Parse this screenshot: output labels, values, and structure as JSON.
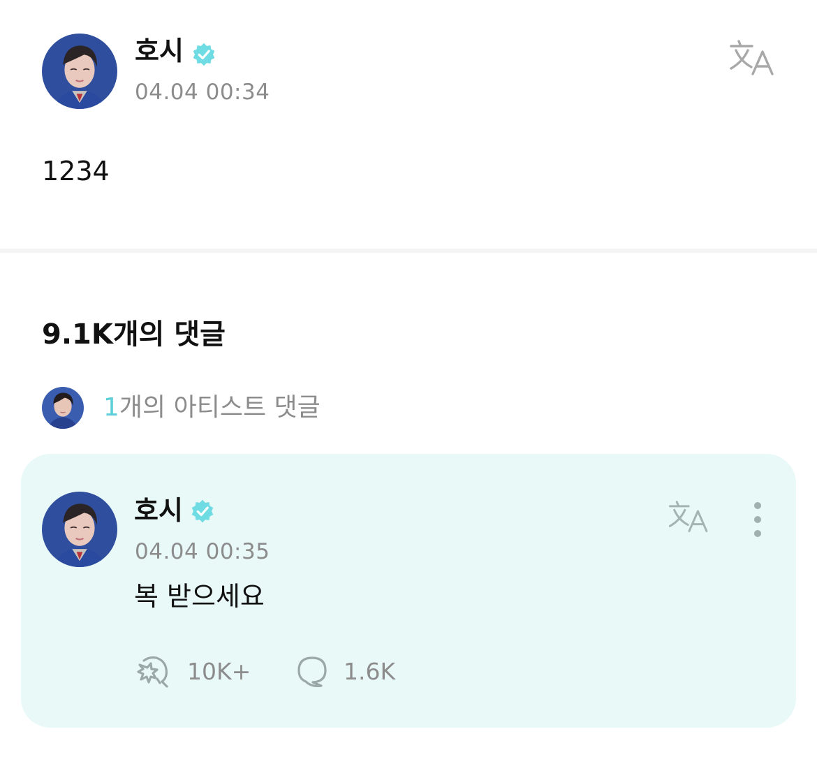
{
  "post": {
    "author_name": "호시",
    "timestamp": "04.04 00:34",
    "body": "1234",
    "translate_icon": "translate-icon",
    "verified_icon": "verified-badge-icon"
  },
  "comments": {
    "title": "9.1K개의 댓글",
    "artist_count": "1",
    "artist_label": "개의 아티스트 댓글"
  },
  "artist_comment": {
    "author_name": "호시",
    "timestamp": "04.04 00:35",
    "body": "복 받으세요",
    "like_count": "10K+",
    "reply_count": "1.6K",
    "like_icon": "cheer-like-icon",
    "reply_icon": "speech-bubble-icon",
    "more_icon": "more-vertical-icon"
  },
  "colors": {
    "accent": "#5ccfd8",
    "verified": "#6fdbe3",
    "card_bg": "#e9f9f7",
    "muted_text": "#8c8c8c",
    "divider": "#f4f4f4"
  }
}
